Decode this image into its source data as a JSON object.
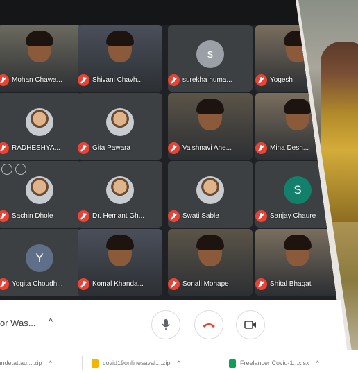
{
  "participants": [
    {
      "name": "Mohan Chawa...",
      "kind": "video"
    },
    {
      "name": "Shivani Chavh...",
      "kind": "video"
    },
    {
      "name": "surekha huma...",
      "kind": "letter",
      "letter": "s",
      "color": "#9aa0a6"
    },
    {
      "name": "Yogesh",
      "kind": "video"
    },
    {
      "name": "RADHESHYA...",
      "kind": "photo"
    },
    {
      "name": "Gita Pawara",
      "kind": "photo"
    },
    {
      "name": "Vaishnavi Ahe...",
      "kind": "video"
    },
    {
      "name": "Mina Desh...",
      "kind": "video"
    },
    {
      "name": "Sachin Dhole",
      "kind": "photo"
    },
    {
      "name": "Dr. Hemant Gh...",
      "kind": "photo"
    },
    {
      "name": "Swati Sable",
      "kind": "photo"
    },
    {
      "name": "Sanjay Chaure",
      "kind": "letter",
      "letter": "S",
      "color": "#12806a"
    },
    {
      "name": "Yogita Choudh...",
      "kind": "letter",
      "letter": "Y",
      "color": "#5f6f8a"
    },
    {
      "name": "Komal Khanda...",
      "kind": "video"
    },
    {
      "name": "Sonali Mohape",
      "kind": "video"
    },
    {
      "name": "Shital Bhagat",
      "kind": "video"
    }
  ],
  "controls": {
    "meeting_label": "or Was...",
    "caret": "^",
    "mic_icon": "mic-icon",
    "end_call_icon": "end-call-icon",
    "camera_icon": "camera-icon"
  },
  "downloads": [
    {
      "name": "vandetattau....zip",
      "icon_color": "#f4b400"
    },
    {
      "name": "covid19onlinesaval....zip",
      "icon_color": "#f4b400"
    },
    {
      "name": "Freelancer Covid-1...xlsx",
      "icon_color": "#0f9d58"
    }
  ],
  "colors": {
    "meet_bg": "#202124",
    "tile_bg": "#3c4043",
    "mute_red": "#ea4335",
    "end_call_red": "#ea4335"
  }
}
